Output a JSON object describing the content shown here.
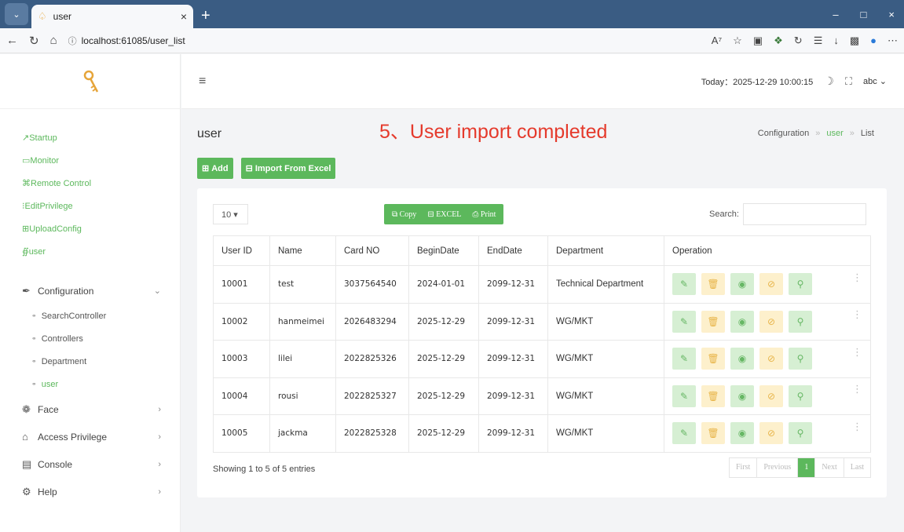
{
  "browser": {
    "tab_title": "user",
    "url": "localhost:61085/user_list"
  },
  "sidebar": {
    "quick": [
      "Startup",
      "Monitor",
      "Remote Control",
      "EditPrivilege",
      "UploadConfig",
      "user"
    ],
    "configuration_label": "Configuration",
    "sub_items": [
      "SearchController",
      "Controllers",
      "Department",
      "user"
    ],
    "face_label": "Face",
    "access_label": "Access Privilege",
    "console_label": "Console",
    "help_label": "Help"
  },
  "header": {
    "today_label": "Today：2025-12-29 10:00:15",
    "user_label": "abc"
  },
  "page": {
    "title": "user",
    "banner": "5、User import completed",
    "breadcrumb": [
      "Configuration",
      "user",
      "List"
    ],
    "add_label": "Add",
    "import_label": "Import From Excel"
  },
  "table_tools": {
    "page_size": "10",
    "copy_label": "Copy",
    "excel_label": "EXCEL",
    "print_label": "Print",
    "search_label": "Search:"
  },
  "table": {
    "columns": [
      "User ID",
      "Name",
      "Card NO",
      "BeginDate",
      "EndDate",
      "Department",
      "Operation"
    ],
    "rows": [
      [
        "10001",
        "test",
        "3037564540",
        "2024-01-01",
        "2099-12-31",
        "Technical Department"
      ],
      [
        "10002",
        "hanmeimei",
        "2026483294",
        "2025-12-29",
        "2099-12-31",
        "WG/MKT"
      ],
      [
        "10003",
        "lilei",
        "2022825326",
        "2025-12-29",
        "2099-12-31",
        "WG/MKT"
      ],
      [
        "10004",
        "rousi",
        "2022825327",
        "2025-12-29",
        "2099-12-31",
        "WG/MKT"
      ],
      [
        "10005",
        "jackma",
        "2022825328",
        "2025-12-29",
        "2099-12-31",
        "WG/MKT"
      ]
    ]
  },
  "footer": {
    "info": "Showing 1 to 5 of 5 entries",
    "pager": [
      "First",
      "Previous",
      "1",
      "Next",
      "Last"
    ]
  },
  "colors": {
    "accent": "#5cb85c",
    "banner": "#e53a2c",
    "browser_bar": "#3a5c83"
  }
}
